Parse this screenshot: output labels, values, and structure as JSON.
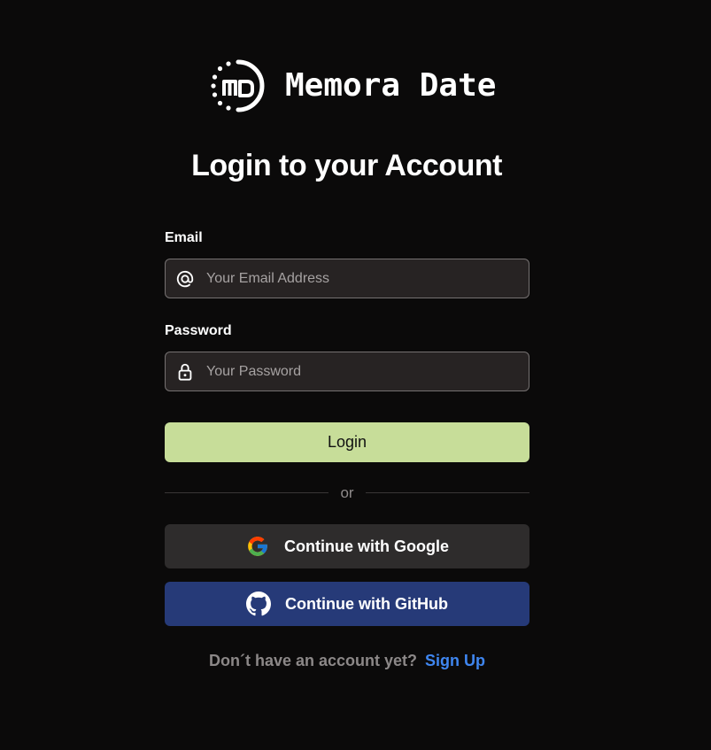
{
  "brand": {
    "name": "Memora Date",
    "logo_icon": "md-logo-icon"
  },
  "page": {
    "title": "Login to your Account"
  },
  "form": {
    "email": {
      "label": "Email",
      "placeholder": "Your Email Address",
      "value": "",
      "icon": "at-sign-icon"
    },
    "password": {
      "label": "Password",
      "placeholder": "Your Password",
      "value": "",
      "icon": "lock-icon"
    },
    "login_label": "Login",
    "divider_text": "or"
  },
  "oauth": {
    "google_label": "Continue with Google",
    "google_icon": "google-icon",
    "github_label": "Continue with GitHub",
    "github_icon": "github-icon"
  },
  "footer": {
    "prompt": "Don´t have an account yet?",
    "signup_label": "Sign Up"
  },
  "colors": {
    "background": "#0b0a0a",
    "input_background": "#272323",
    "input_border": "#757171",
    "login_button": "#c7dd99",
    "google_button": "#2e2c2c",
    "github_button": "#263a78",
    "link": "#3f86f0"
  }
}
